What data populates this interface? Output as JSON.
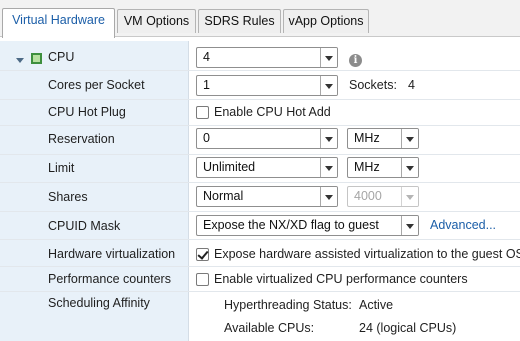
{
  "tabs": [
    {
      "label": "Virtual Hardware"
    },
    {
      "label": "VM Options"
    },
    {
      "label": "SDRS Rules"
    },
    {
      "label": "vApp Options"
    }
  ],
  "cpu": {
    "label": "CPU",
    "value": "4",
    "info_icon": "info-icon"
  },
  "cores_per_socket": {
    "label": "Cores per Socket",
    "value": "1",
    "sockets_label": "Sockets:",
    "sockets_value": "4"
  },
  "cpu_hot_plug": {
    "label": "CPU Hot Plug",
    "checkbox_label": "Enable CPU Hot Add",
    "checked": false
  },
  "reservation": {
    "label": "Reservation",
    "value": "0",
    "unit": "MHz"
  },
  "limit": {
    "label": "Limit",
    "value": "Unlimited",
    "unit": "MHz"
  },
  "shares": {
    "label": "Shares",
    "value": "Normal",
    "amount": "4000"
  },
  "cpuid_mask": {
    "label": "CPUID Mask",
    "value": "Expose the NX/XD flag to guest",
    "advanced_link": "Advanced..."
  },
  "hardware_virtualization": {
    "label": "Hardware virtualization",
    "checkbox_label": "Expose hardware assisted virtualization to the guest OS",
    "checked": true
  },
  "performance_counters": {
    "label": "Performance counters",
    "checkbox_label": "Enable virtualized CPU performance counters",
    "checked": false
  },
  "scheduling_affinity": {
    "label": "Scheduling Affinity",
    "hyperthreading_label": "Hyperthreading Status:",
    "hyperthreading_value": "Active",
    "available_cpus_label": "Available CPUs:",
    "available_cpus_value": "24 (logical CPUs)"
  },
  "colors": {
    "label_column_bg": "#e8f1f9",
    "active_tab_text": "#1b5ea8",
    "link": "#1b5ea8"
  }
}
